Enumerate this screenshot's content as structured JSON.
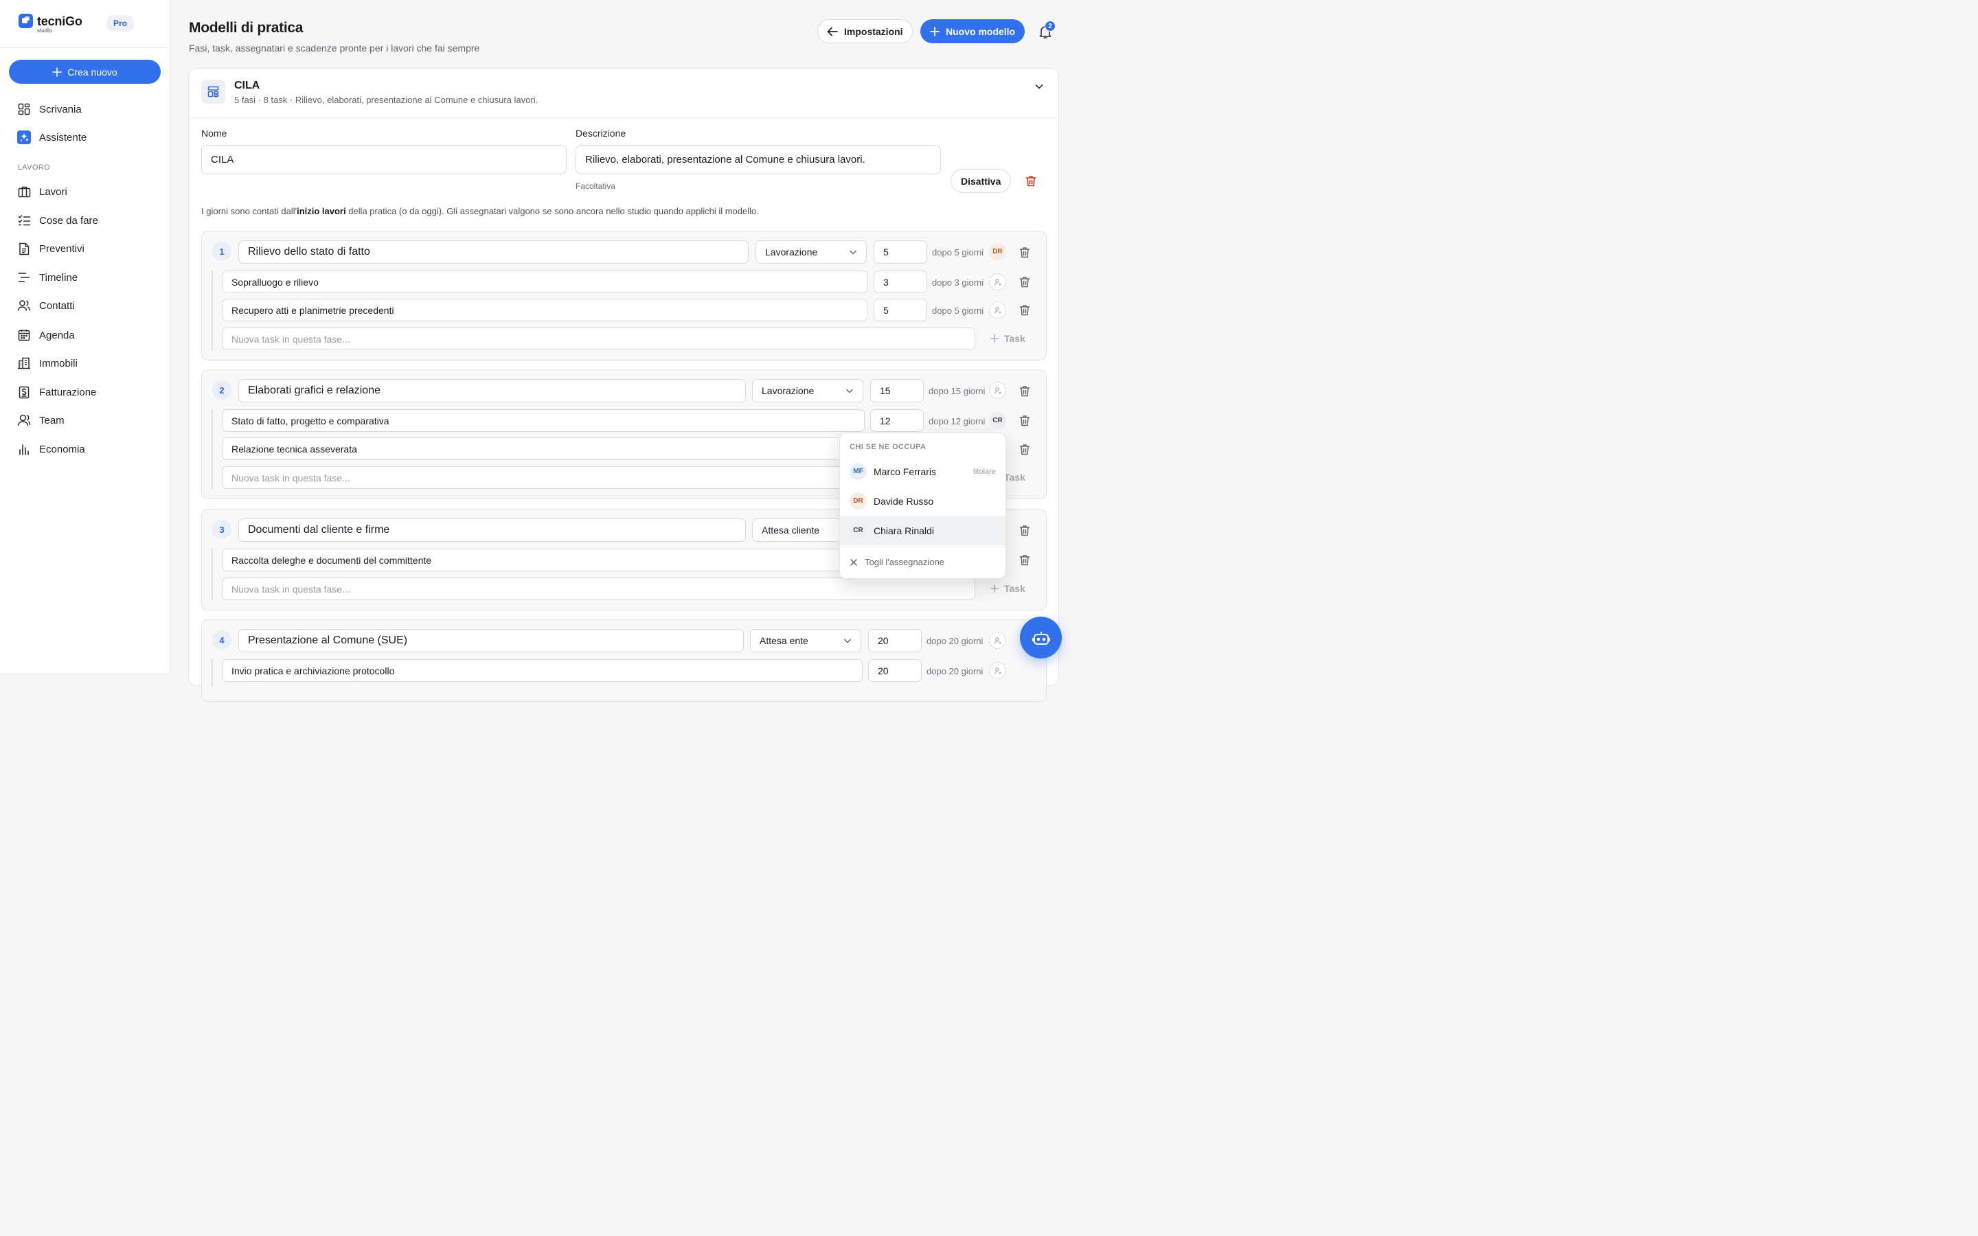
{
  "brand": {
    "name": "tecniGo",
    "sub": "studio",
    "plan": "Pro"
  },
  "sidebar": {
    "create_label": "Crea nuovo",
    "top_items": [
      {
        "label": "Scrivania",
        "icon": "grid-icon"
      },
      {
        "label": "Assistente",
        "icon": "sparkle-icon"
      }
    ],
    "section_label": "LAVORO",
    "items": [
      {
        "label": "Lavori",
        "icon": "briefcase-icon"
      },
      {
        "label": "Cose da fare",
        "icon": "checklist-icon"
      },
      {
        "label": "Preventivi",
        "icon": "document-icon"
      },
      {
        "label": "Timeline",
        "icon": "timeline-icon"
      },
      {
        "label": "Contatti",
        "icon": "users-icon"
      },
      {
        "label": "Agenda",
        "icon": "calendar-icon"
      },
      {
        "label": "Immobili",
        "icon": "building-icon"
      },
      {
        "label": "Fatturazione",
        "icon": "invoice-icon"
      },
      {
        "label": "Team",
        "icon": "team-icon"
      },
      {
        "label": "Economia",
        "icon": "bar-chart-icon"
      }
    ]
  },
  "header": {
    "title": "Modelli di pratica",
    "subtitle": "Fasi, task, assegnatari e scadenze pronte per i lavori che fai sempre",
    "back_label": "Impostazioni",
    "new_label": "Nuovo modello",
    "notifications": "2"
  },
  "template": {
    "title": "CILA",
    "summary": "5 fasi · 8 task · Rilievo, elaborati, presentazione al Comune e chiusura lavori.",
    "name_label": "Nome",
    "name_value": "CILA",
    "desc_label": "Descrizione",
    "desc_value": "Rilievo, elaborati, presentazione al Comune e chiusura lavori.",
    "desc_hint": "Facoltativa",
    "deactivate_label": "Disattiva",
    "note_pre": "I giorni sono contati dall'",
    "note_bold": "inizio lavori",
    "note_post": " della pratica (o da oggi). Gli assegnatari valgono se sono ancora nello studio quando applichi il modello.",
    "new_task_placeholder": "Nuova task in questa fase...",
    "add_task_label": "Task"
  },
  "phases": [
    {
      "num": "1",
      "name": "Rilievo dello stato di fatto",
      "status": "Lavorazione",
      "days": "5",
      "after": "dopo 5 giorni",
      "assignee": "DR",
      "tasks": [
        {
          "name": "Sopralluogo e rilievo",
          "days": "3",
          "after": "dopo 3 giorni"
        },
        {
          "name": "Recupero atti e planimetrie precedenti",
          "days": "5",
          "after": "dopo 5 giorni"
        }
      ]
    },
    {
      "num": "2",
      "name": "Elaborati grafici e relazione",
      "status": "Lavorazione",
      "days": "15",
      "after": "dopo 15 giorni",
      "tasks": [
        {
          "name": "Stato di fatto, progetto e comparativa",
          "days": "12",
          "after": "dopo 12 giorni",
          "assignee": "CR"
        },
        {
          "name": "Relazione tecnica asseverata"
        }
      ]
    },
    {
      "num": "3",
      "name": "Documenti dal cliente e firme",
      "status": "Attesa cliente",
      "tasks": [
        {
          "name": "Raccolta deleghe e documenti del committente"
        }
      ]
    },
    {
      "num": "4",
      "name": "Presentazione al Comune (SUE)",
      "status": "Attesa ente",
      "days": "20",
      "after": "dopo 20 giorni",
      "tasks": [
        {
          "name": "Invio pratica e archiviazione protocollo",
          "days": "20",
          "after": "dopo 20 giorni"
        }
      ]
    }
  ],
  "dropdown": {
    "header": "CHI SE NE OCCUPA",
    "people": [
      {
        "initials": "MF",
        "name": "Marco Ferraris",
        "tag": "titolare"
      },
      {
        "initials": "DR",
        "name": "Davide Russo"
      },
      {
        "initials": "CR",
        "name": "Chiara Rinaldi"
      }
    ],
    "remove_label": "Togli l'assegnazione"
  },
  "colors": {
    "accent": "#3370ec",
    "danger": "#d92d20"
  }
}
